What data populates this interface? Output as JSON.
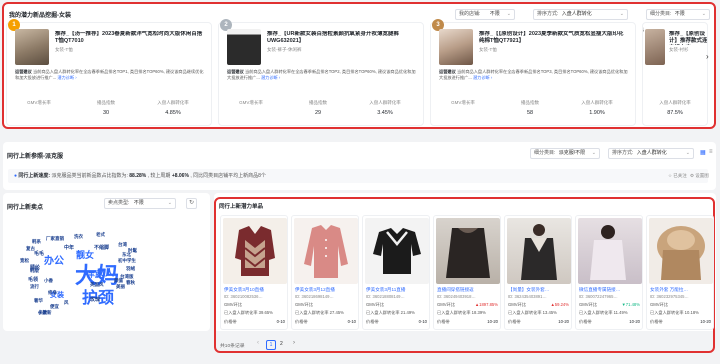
{
  "top": {
    "title": "我的潜力新品挖掘-女装",
    "filters": [
      {
        "label": "我的店铺:",
        "value": "不限"
      },
      {
        "label": "排序方式:",
        "value": "入盘人群转化"
      },
      {
        "label": "细分类目:",
        "value": "不限"
      }
    ],
    "metric_labels": [
      "GMV增长率",
      "播品指数",
      "入盘人群转化率"
    ],
    "cards": [
      {
        "rank": "1",
        "title": "推荐_【汤一推荐】2023春夏新款洋气宽松时尚大版休闲百搭T恤QT7010",
        "cat": "女装-T恤",
        "strategy_label": "运营建议",
        "strategy": "当前商品入盘人群转化率在全店春季新品排名TOP1, 类目排名TOP60%, 建议该商品继续优化和加大投放进行推广...",
        "more": "潜力诊断 ›",
        "metrics": [
          "",
          "30",
          "4.85%"
        ]
      },
      {
        "rank": "2",
        "title": "推荐_【UR新款女装百搭粒素颜抗氧紧身开衩薄宽腿裤UWG632021】",
        "cat": "女装-裤子-休闲裤",
        "strategy_label": "运营建议",
        "strategy": "当前商品入盘人群转化率在全店春季新品排名TOP2, 类目排名TOP60%, 建议该商品优化和加大投放进行推广...",
        "more": "潜力诊断 ›",
        "metrics": [
          "",
          "29",
          "3.45%"
        ]
      },
      {
        "rank": "3",
        "title": "推荐_【【原创设计】2023夏季新款女气质宽松显瘦大版印花纯棉T恤QT7921】",
        "cat": "女装-T恤",
        "strategy_label": "运营建议",
        "strategy": "当前商品入盘人群转化率在全店春季新品排名TOP3, 类目排名TOP60%, 建议该商品优化和加大投放进行推广...",
        "more": "潜力诊断 ›",
        "metrics": [
          "",
          "58",
          "1.90%"
        ]
      },
      {
        "rank": "4",
        "title": "推荐_【原创设计】推荐款式连衣裙上衣QT7809】",
        "cat": "女装-衬衫",
        "strategy_label": "运营建议",
        "strategy": "当前商品入盘人群转化率在全店春季新品排名TOP4...",
        "more": "",
        "metrics": [
          "",
          "",
          "87.5%"
        ]
      }
    ]
  },
  "section2": {
    "title": "同行上新参照-派克服",
    "filters": [
      {
        "label": "细分类目:",
        "value": "派克服/不限"
      },
      {
        "label": "排序方式:",
        "value": "入盘人群转化"
      }
    ],
    "trend_label": "同行上新速度:",
    "trend_text": "派克服品类当前新品数占比指数为:",
    "trend_value": "88.28%",
    "trend_text2": ", 较上周期",
    "trend_change": "+8.06%",
    "trend_text3": ", 同比同类目店铺平均上新商品8个",
    "right_links": [
      "已关注",
      "设置图"
    ]
  },
  "keywords": {
    "title": "同行上新卖点",
    "filter_label": "卖点类型:",
    "filter_value": "不限",
    "words": [
      {
        "t": "大妈",
        "c": "#2f6bff",
        "s": 22
      },
      {
        "t": "护颈",
        "c": "#2f6bff",
        "s": 16
      },
      {
        "t": "办公",
        "c": "#2f6bff",
        "s": 10
      },
      {
        "t": "靓女",
        "c": "#2f6bff",
        "s": 9
      },
      {
        "t": "女人",
        "c": "#2f6bff",
        "s": 9
      },
      {
        "t": "羊皮",
        "c": "#2f6bff",
        "s": 7
      },
      {
        "t": "女装",
        "c": "#2f6bff",
        "s": 7
      },
      {
        "t": "不缩脚",
        "c": "#1a3f8f",
        "s": 5
      },
      {
        "t": "毛毛",
        "c": "#1a3f8f",
        "s": 5
      },
      {
        "t": "毛领",
        "c": "#1a3f8f",
        "s": 5
      },
      {
        "t": "腈纶",
        "c": "#1a3f8f",
        "s": 5
      },
      {
        "t": "中年",
        "c": "#1a3f8f",
        "s": 5
      },
      {
        "t": "玫瑰",
        "c": "#1a3f8f",
        "s": 5
      },
      {
        "t": "厂家直销",
        "c": "#1a3f8f",
        "s": 4.5
      },
      {
        "t": "韩系",
        "c": "#1a3f8f",
        "s": 4.5
      },
      {
        "t": "洗衣",
        "c": "#1a3f8f",
        "s": 4.5
      },
      {
        "t": "老式",
        "c": "#1a3f8f",
        "s": 4.5
      },
      {
        "t": "东北",
        "c": "#1a3f8f",
        "s": 4.5
      },
      {
        "t": "时髦",
        "c": "#1a3f8f",
        "s": 4.5
      },
      {
        "t": "台湾",
        "c": "#1a3f8f",
        "s": 4.5
      },
      {
        "t": "羽绒",
        "c": "#1a3f8f",
        "s": 4.5
      },
      {
        "t": "颜值",
        "c": "#1a3f8f",
        "s": 4.5
      },
      {
        "t": "台湾版",
        "c": "#1a3f8f",
        "s": 4.5
      },
      {
        "t": "初中学生",
        "c": "#1a3f8f",
        "s": 4.5
      },
      {
        "t": "宽松",
        "c": "#1a3f8f",
        "s": 4.5
      },
      {
        "t": "复古",
        "c": "#1a3f8f",
        "s": 4.5
      },
      {
        "t": "韩版",
        "c": "#1a3f8f",
        "s": 4.5
      },
      {
        "t": "流行",
        "c": "#1a3f8f",
        "s": 4.5
      },
      {
        "t": "小清新",
        "c": "#1a3f8f",
        "s": 4.5
      },
      {
        "t": "便宜",
        "c": "#1a3f8f",
        "s": 4.5
      },
      {
        "t": "修身",
        "c": "#1a3f8f",
        "s": 4.5
      },
      {
        "t": "奢华",
        "c": "#1a3f8f",
        "s": 4.5
      },
      {
        "t": "小香",
        "c": "#1a3f8f",
        "s": 4.5
      },
      {
        "t": "风",
        "c": "#1a3f8f",
        "s": 4.5
      },
      {
        "t": "长款",
        "c": "#1a3f8f",
        "s": 4.5
      },
      {
        "t": "春秋",
        "c": "#1a3f8f",
        "s": 4.5
      },
      {
        "t": "美丽",
        "c": "#1a3f8f",
        "s": 4.5
      },
      {
        "t": "英国风",
        "c": "#1a3f8f",
        "s": 4.5
      }
    ]
  },
  "products": {
    "title": "同行上新潜力单品",
    "items": [
      {
        "title": "伊美女装3月10直播",
        "id": "ID: 360210082536…",
        "gmv_label": "GMV环比",
        "gmv": "",
        "conv_label": "已入盘人群转化率 39.65%",
        "price_label": "价格带",
        "price": "0-10"
      },
      {
        "title": "伊美女装3月12直播",
        "id": "ID: 360218698149…",
        "gmv_label": "GMV环比",
        "gmv": "",
        "conv_label": "已入盘人群转化率 27.45%",
        "price_label": "价格带",
        "price": "0-10"
      },
      {
        "title": "伊美女装3月11直播",
        "id": "ID: 360218808149…",
        "gmv_label": "GMV环比",
        "gmv": "",
        "conv_label": "已入盘人群转化率 21.49%",
        "price_label": "价格带",
        "price": "0-10"
      },
      {
        "title": "直播间穿搭链接返",
        "id": "ID: 360249403918…",
        "gmv_label": "GMV环比",
        "gmv": "▲1897.85%",
        "conv_label": "已入盘人群转化率 18.39%",
        "price_label": "价格带",
        "price": "10-20"
      },
      {
        "title": "【尚量】女装外套…",
        "id": "ID: 362435403891…",
        "gmv_label": "GMV环比",
        "gmv": "▲59.24%",
        "conv_label": "已入盘人群转化率 13.45%",
        "price_label": "价格带",
        "price": "10-20"
      },
      {
        "title": "微信直播专属链接…",
        "id": "ID: 360072247965…",
        "gmv_label": "GMV环比",
        "gmv": "▼71.48%",
        "conv_label": "已入盘人群转化率 11.49%",
        "price_label": "价格带",
        "price": "10-20"
      },
      {
        "title": "女装外套 万能拉…",
        "id": "ID: 360232975345…",
        "gmv_label": "GMV环比",
        "gmv": "",
        "conv_label": "已入盘人群转化率 10.18%",
        "price_label": "价格带",
        "price": "10-20"
      }
    ],
    "pagination": {
      "total": "共10条记录",
      "pages": [
        "1",
        "2"
      ],
      "next": "›",
      "prev": "‹"
    }
  },
  "colors": {
    "accent": "#2f6bff",
    "red": "#e03131",
    "green": "#12b886",
    "orange": "#f59f00"
  }
}
